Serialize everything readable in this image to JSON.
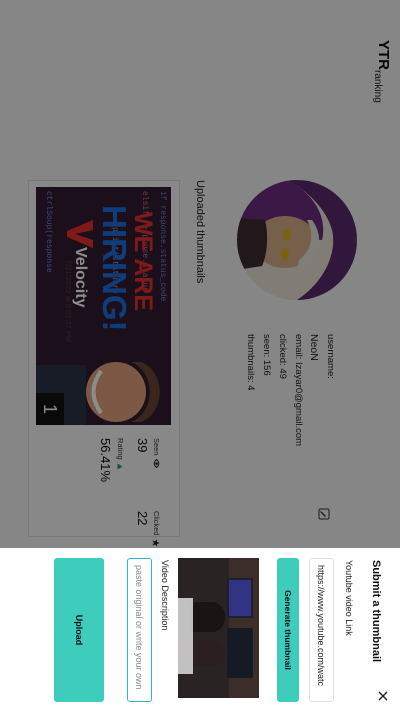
{
  "app": {
    "logo": "YTR",
    "nav_ranking": "ranking"
  },
  "profile": {
    "username_label": "username:",
    "username": "NeoN",
    "email": "email: Izayar0@gmail.com",
    "clicked": "clicked: 49",
    "seen": "seen: 156",
    "thumbnails": "thumbnails: 4"
  },
  "uploads": {
    "title": "Uploaded thumbnails",
    "items": [
      {
        "rank": "1",
        "seen_label": "Seen",
        "seen_value": "39",
        "clicked_label": "Clicked",
        "clicked_value": "22",
        "rating_label": "Rating",
        "rating_value": "56.41%",
        "date": "7/21/2022 at 9:02:37 PM",
        "thumb_text": {
          "line1": "WE ARE",
          "line2": "HIRING!",
          "brand": "Velocity",
          "code1": "if response.status_code",
          "code2": "elsif response.status",
          "code3": "print(statusr)",
          "code4": "ctrlSoup(response"
        }
      }
    ]
  },
  "sheet": {
    "title": "Submit a thumbnail",
    "link_label": "Youtube video Link",
    "link_value": "https://www.youtube.com/watc",
    "generate_label": "Generate thumbnail",
    "description_label": "Video Description",
    "description_placeholder": "paste original or write your own",
    "upload_label": "Upload"
  },
  "colors": {
    "accent": "#3ecdbd",
    "focus_border": "#2fb7cf",
    "rating_up": "#2e9b4f",
    "thumb_red": "#e8312d",
    "thumb_blue": "#1d6fe0"
  }
}
